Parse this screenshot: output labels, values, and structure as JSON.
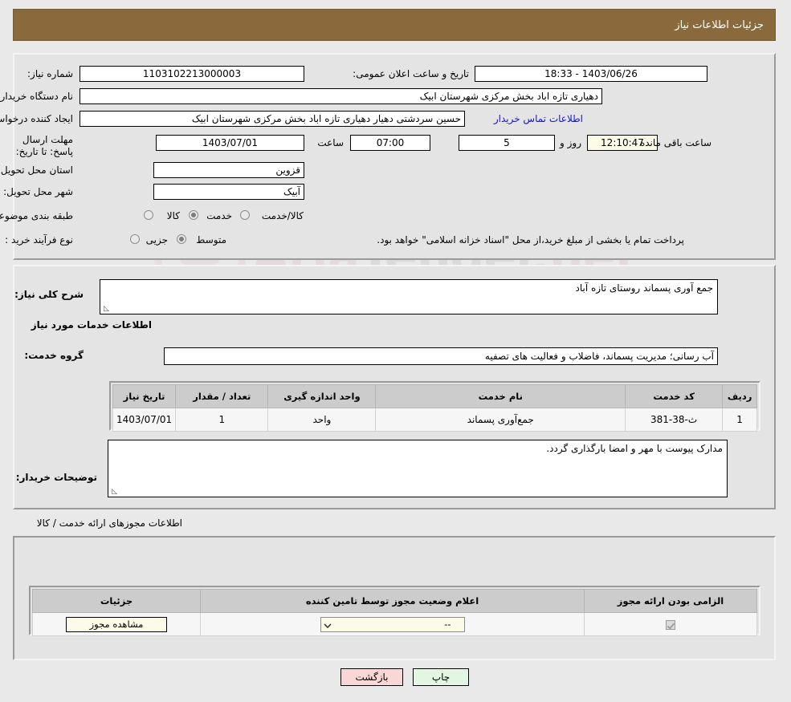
{
  "header": {
    "title": "جزئیات اطلاعات نیاز"
  },
  "top": {
    "need_number_label": "شماره نیاز:",
    "need_number_value": "1103102213000003",
    "announce_label": "تاریخ و ساعت اعلان عمومی:",
    "announce_value": "1403/06/26 - 18:33",
    "buyer_org_label": "نام دستگاه خریدار:",
    "buyer_org_value": "دهیاری تازه اباد بخش مرکزی شهرستان ابیک",
    "creator_label": "ایجاد کننده درخواست:",
    "creator_value": "حسین سردشتی دهیار دهیاری تازه اباد بخش مرکزی شهرستان ابیک",
    "contact_link": "اطلاعات تماس خریدار",
    "deadline_label": "مهلت ارسال پاسخ: تا تاریخ:",
    "deadline_date": "1403/07/01",
    "hour_label": "ساعت",
    "deadline_time": "07:00",
    "days_value": "5",
    "days_label": "روز و",
    "countdown_value": "12:10:47",
    "remaining_label": "ساعت باقی مانده",
    "province_label": "استان محل تحویل:",
    "province_value": "قزوین",
    "city_label": "شهر محل تحویل:",
    "city_value": "آبیک",
    "category_label": "طبقه بندی موضوعی:",
    "category_options": [
      "کالا",
      "خدمت",
      "کالا/خدمت"
    ],
    "category_selected": "خدمت",
    "process_label": "نوع فرآیند خرید :",
    "process_options": [
      "جزیی",
      "متوسط"
    ],
    "process_selected": "متوسط",
    "process_note": "پرداخت تمام یا بخشی از مبلغ خرید،از محل \"اسناد خزانه اسلامی\" خواهد بود."
  },
  "mid": {
    "summary_label": "شرح کلی نیاز:",
    "summary_value": "جمع آوری پسماند روستای تازه آباد",
    "services_heading": "اطلاعات خدمات مورد نیاز",
    "service_group_label": "گروه خدمت:",
    "service_group_value": "آب رسانی؛ مدیریت پسماند، فاضلاب و فعالیت های تصفیه",
    "table": {
      "headers": [
        "ردیف",
        "کد خدمت",
        "نام خدمت",
        "واحد اندازه گیری",
        "تعداد / مقدار",
        "تاریخ نیاز"
      ],
      "rows": [
        [
          "1",
          "ث-38-381",
          "جمع‌آوری پسماند",
          "واحد",
          "1",
          "1403/07/01"
        ]
      ]
    },
    "buyer_notes_label": "توضیحات خریدار:",
    "buyer_notes_value": "مدارک پیوست با مهر و امضا بارگذاری گردد."
  },
  "permits": {
    "heading": "اطلاعات مجوزهای ارائه خدمت / کالا",
    "table": {
      "headers": [
        "الزامی بودن ارائه مجوز",
        "اعلام وضعیت مجوز توسط تامین کننده",
        "جزئیات"
      ],
      "rows": [
        {
          "required": true,
          "status": "--",
          "details_button": "مشاهده مجوز"
        }
      ]
    }
  },
  "footer": {
    "print_label": "چاپ",
    "back_label": "بازگشت"
  },
  "watermark": {
    "text_left": "Aria",
    "text_right": "Tender",
    "text_tail": ".net"
  },
  "colors": {
    "header_bg": "#8a6a3c",
    "link": "#1414cf",
    "print_btn": "#e2f6e2",
    "back_btn": "#fad7d7",
    "cream_field": "#fbfbe8"
  }
}
